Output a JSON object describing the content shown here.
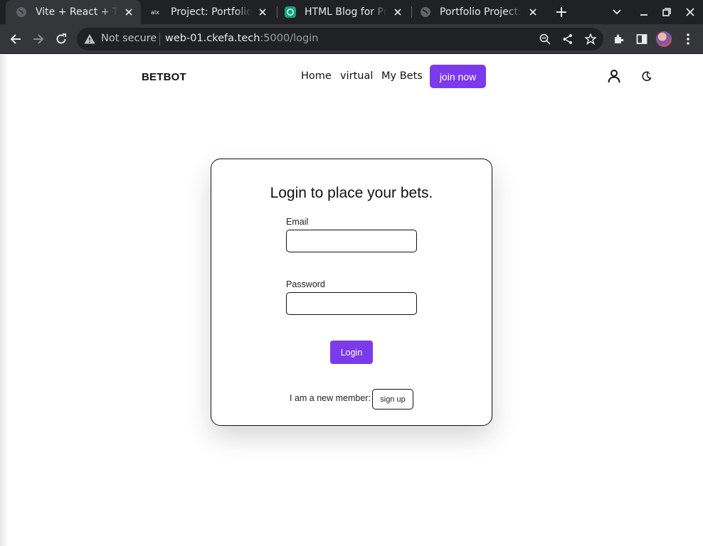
{
  "browser": {
    "tabs": [
      {
        "title": "Vite + React + TS",
        "favicon": "globe-icon",
        "active": true
      },
      {
        "title": "Project: Portfolio Project",
        "favicon": "alx-icon",
        "active": false
      },
      {
        "title": "HTML Blog for Project",
        "favicon": "openai-icon",
        "active": false
      },
      {
        "title": "Portfolio Project: Blog",
        "favicon": "globe-icon",
        "active": false
      }
    ],
    "omnibox": {
      "security_label": "Not secure",
      "url_host": "web-01.ckefa.tech",
      "url_rest": ":5000/login"
    },
    "colors": {
      "tabstrip": "#202124",
      "toolbar": "#35363a"
    }
  },
  "site": {
    "brand": "BETBOT",
    "nav": {
      "home": "Home",
      "virtual": "virtual",
      "my_bets": "My Bets",
      "join": "join now"
    },
    "icons": {
      "user": "user-icon",
      "theme": "theme-toggle-icon"
    },
    "accent_color": "#7c3aed"
  },
  "login": {
    "title": "Login to place your bets.",
    "email_label": "Email",
    "email_value": "",
    "password_label": "Password",
    "password_value": "",
    "submit_label": "Login",
    "member_text": "I am a new member:",
    "signup_label": "sign up"
  }
}
